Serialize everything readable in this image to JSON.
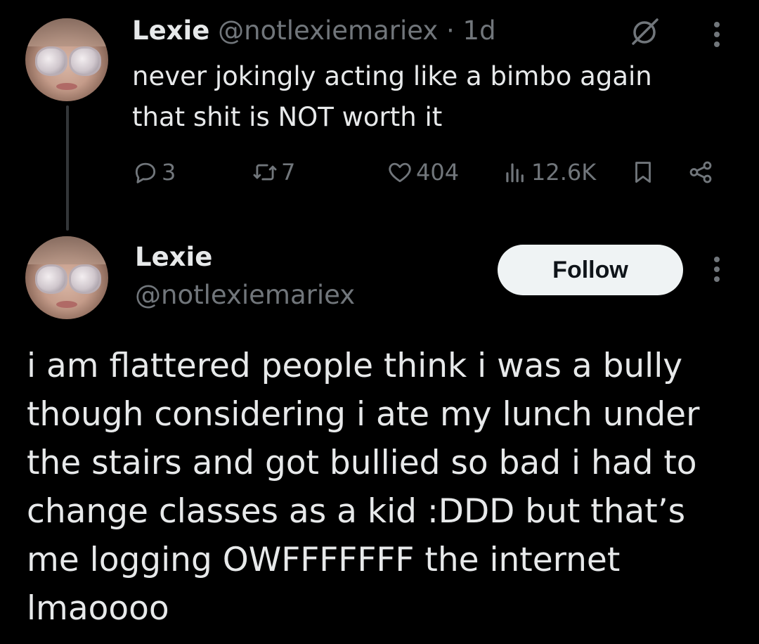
{
  "tweet1": {
    "display_name": "Lexie",
    "handle": "@notlexiemariex",
    "separator": "·",
    "time": "1d",
    "text_line1": "never jokingly acting like a bimbo again",
    "text_line2": "that shit is NOT worth it",
    "metrics": {
      "replies": "3",
      "reposts": "7",
      "likes": "404",
      "views": "12.6K"
    }
  },
  "tweet2": {
    "display_name": "Lexie",
    "handle": "@notlexiemariex",
    "follow_label": "Follow",
    "text": "i am flattered people think i was a bully though considering i ate my lunch under the stairs and got bullied so bad i had to change classes as a kid :DDD but that’s me logging OWFFFFFFF the internet lmaoooo"
  },
  "colors": {
    "background": "#000000",
    "primary_text": "#e7e9ea",
    "secondary_text": "#71767b",
    "follow_button_bg": "#eff3f4"
  },
  "icons": [
    "grok-icon",
    "more-icon",
    "reply-icon",
    "repost-icon",
    "like-icon",
    "views-icon",
    "bookmark-icon",
    "share-icon"
  ]
}
